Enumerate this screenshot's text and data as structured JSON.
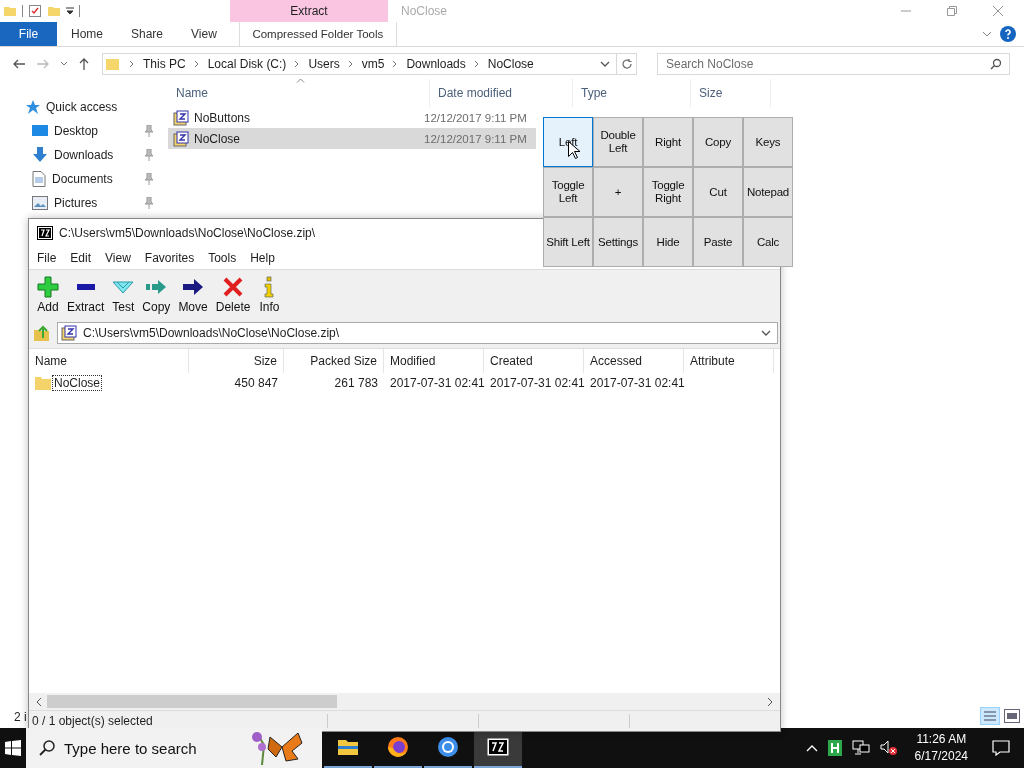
{
  "explorer": {
    "title": "NoClose",
    "context_group": "Extract",
    "ribbon_tabs": [
      {
        "label": "File",
        "kind": "file",
        "selected": false
      },
      {
        "label": "Home",
        "kind": "tab",
        "selected": false
      },
      {
        "label": "Share",
        "kind": "tab",
        "selected": false
      },
      {
        "label": "View",
        "kind": "tab",
        "selected": false
      },
      {
        "label": "Compressed Folder Tools",
        "kind": "context",
        "selected": false
      }
    ],
    "breadcrumb": [
      "This PC",
      "Local Disk (C:)",
      "Users",
      "vm5",
      "Downloads",
      "NoClose"
    ],
    "search": {
      "placeholder": "Search NoClose"
    },
    "sidebar": [
      {
        "label": "Quick access",
        "kind": "star",
        "pinned": false
      },
      {
        "label": "Desktop",
        "kind": "desktop",
        "pinned": true
      },
      {
        "label": "Downloads",
        "kind": "download",
        "pinned": true
      },
      {
        "label": "Documents",
        "kind": "document",
        "pinned": true
      },
      {
        "label": "Pictures",
        "kind": "picture",
        "pinned": true
      }
    ],
    "columns": [
      "Name",
      "Date modified",
      "Type",
      "Size"
    ],
    "files": [
      {
        "name": "NoButtons",
        "date": "12/12/2017 9:11 PM",
        "selected": false
      },
      {
        "name": "NoClose",
        "date": "12/12/2017 9:11 PM",
        "selected": true
      }
    ],
    "status": "2 i"
  },
  "button_panel": [
    {
      "label": "Left",
      "hovered": true
    },
    {
      "label": "Double Left",
      "hovered": false
    },
    {
      "label": "Right",
      "hovered": false
    },
    {
      "label": "Copy",
      "hovered": false
    },
    {
      "label": "Keys",
      "hovered": false
    },
    {
      "label": "Toggle Left",
      "hovered": false
    },
    {
      "label": "+",
      "hovered": false
    },
    {
      "label": "Toggle Right",
      "hovered": false
    },
    {
      "label": "Cut",
      "hovered": false
    },
    {
      "label": "Notepad",
      "hovered": false
    },
    {
      "label": "Shift Left",
      "hovered": false
    },
    {
      "label": "Settings",
      "hovered": false
    },
    {
      "label": "Hide",
      "hovered": false
    },
    {
      "label": "Paste",
      "hovered": false
    },
    {
      "label": "Calc",
      "hovered": false
    }
  ],
  "sevenzip": {
    "title": "C:\\Users\\vm5\\Downloads\\NoClose\\NoClose.zip\\",
    "menu": [
      "File",
      "Edit",
      "View",
      "Favorites",
      "Tools",
      "Help"
    ],
    "toolbar": [
      {
        "label": "Add",
        "kind": "add"
      },
      {
        "label": "Extract",
        "kind": "extract"
      },
      {
        "label": "Test",
        "kind": "test"
      },
      {
        "label": "Copy",
        "kind": "copy"
      },
      {
        "label": "Move",
        "kind": "move"
      },
      {
        "label": "Delete",
        "kind": "delete"
      },
      {
        "label": "Info",
        "kind": "info"
      }
    ],
    "path": "C:\\Users\\vm5\\Downloads\\NoClose\\NoClose.zip\\",
    "columns": [
      "Name",
      "Size",
      "Packed Size",
      "Modified",
      "Created",
      "Accessed",
      "Attribute"
    ],
    "rows": [
      {
        "cells": [
          "NoClose",
          "450 847",
          "261 783",
          "2017-07-31 02:41",
          "2017-07-31 02:41",
          "2017-07-31 02:41"
        ],
        "selected": false
      }
    ],
    "status": "0 / 1 object(s) selected"
  },
  "taskbar": {
    "search_placeholder": "Type here to search",
    "apps": [
      {
        "kind": "explorer",
        "running": true,
        "selected": false
      },
      {
        "kind": "firefox",
        "running": true,
        "selected": false
      },
      {
        "kind": "chrome",
        "running": true,
        "selected": false
      },
      {
        "kind": "sevenzip",
        "running": true,
        "selected": true
      }
    ],
    "time": "11:26 AM",
    "date": "6/17/2024"
  }
}
